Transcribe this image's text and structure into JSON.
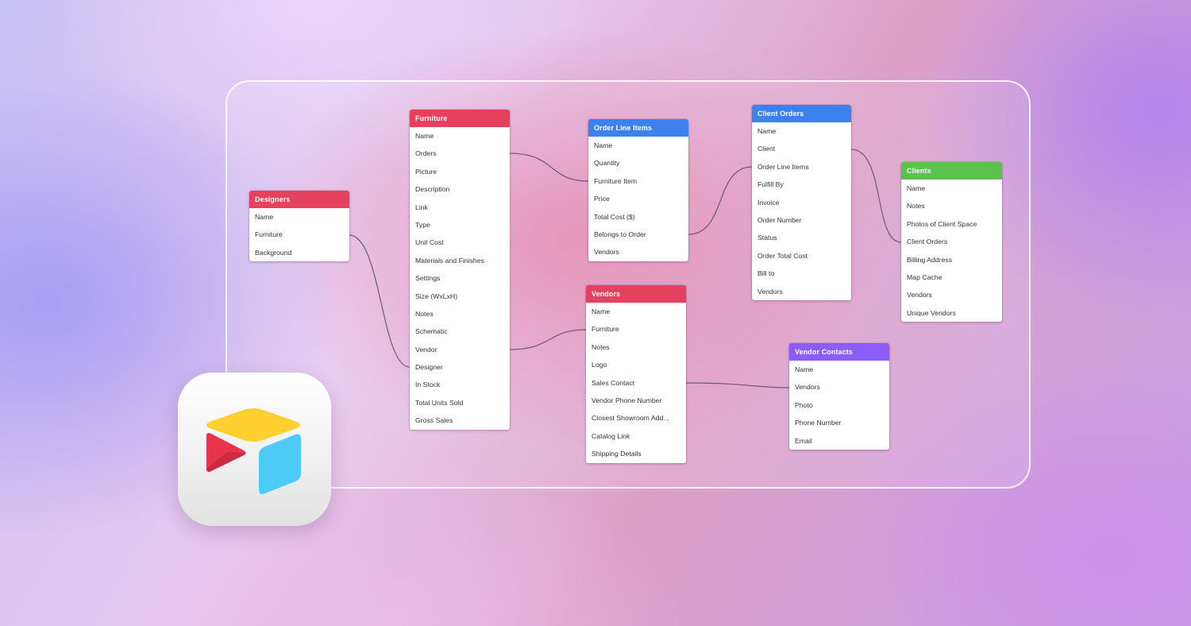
{
  "colors": {
    "red": "#e5405e",
    "blue": "#3b82f0",
    "green": "#5cc14d",
    "purple": "#8b5cf6",
    "link": "#6e5a6e"
  },
  "logo": {
    "name": "Airtable",
    "icon": "airtable-logo-icon"
  },
  "tables": {
    "designers": {
      "title": "Designers",
      "fields": [
        "Name",
        "Furniture",
        "Background"
      ]
    },
    "furniture": {
      "title": "Furniture",
      "fields": [
        "Name",
        "Orders",
        "Picture",
        "Description",
        "Link",
        "Type",
        "Unit Cost",
        "Materials and Finishes",
        "Settings",
        "Size (WxLxH)",
        "Notes",
        "Schematic",
        "Vendor",
        "Designer",
        "In Stock",
        "Total Units Sold",
        "Gross Sales"
      ]
    },
    "order_line_items": {
      "title": "Order Line Items",
      "fields": [
        "Name",
        "Quantity",
        "Furniture Item",
        "Price",
        "Total Cost ($)",
        "Belongs to Order",
        "Vendors"
      ]
    },
    "vendors": {
      "title": "Vendors",
      "fields": [
        "Name",
        "Furniture",
        "Notes",
        "Logo",
        "Sales Contact",
        "Vendor Phone Number",
        "Closest Showroom Add...",
        "Catalog Link",
        "Shipping Details"
      ]
    },
    "client_orders": {
      "title": "Client Orders",
      "fields": [
        "Name",
        "Client",
        "Order Line Items",
        "Fulfill By",
        "Invoice",
        "Order Number",
        "Status",
        "Order Total Cost",
        "Bill to",
        "Vendors"
      ]
    },
    "clients": {
      "title": "Clients",
      "fields": [
        "Name",
        "Notes",
        "Photos of Client Space",
        "Client Orders",
        "Billing Address",
        "Map Cache",
        "Vendors",
        "Unique Vendors"
      ]
    },
    "vendor_contacts": {
      "title": "Vendor Contacts",
      "fields": [
        "Name",
        "Vendors",
        "Photo",
        "Phone Number",
        "Email"
      ]
    }
  }
}
